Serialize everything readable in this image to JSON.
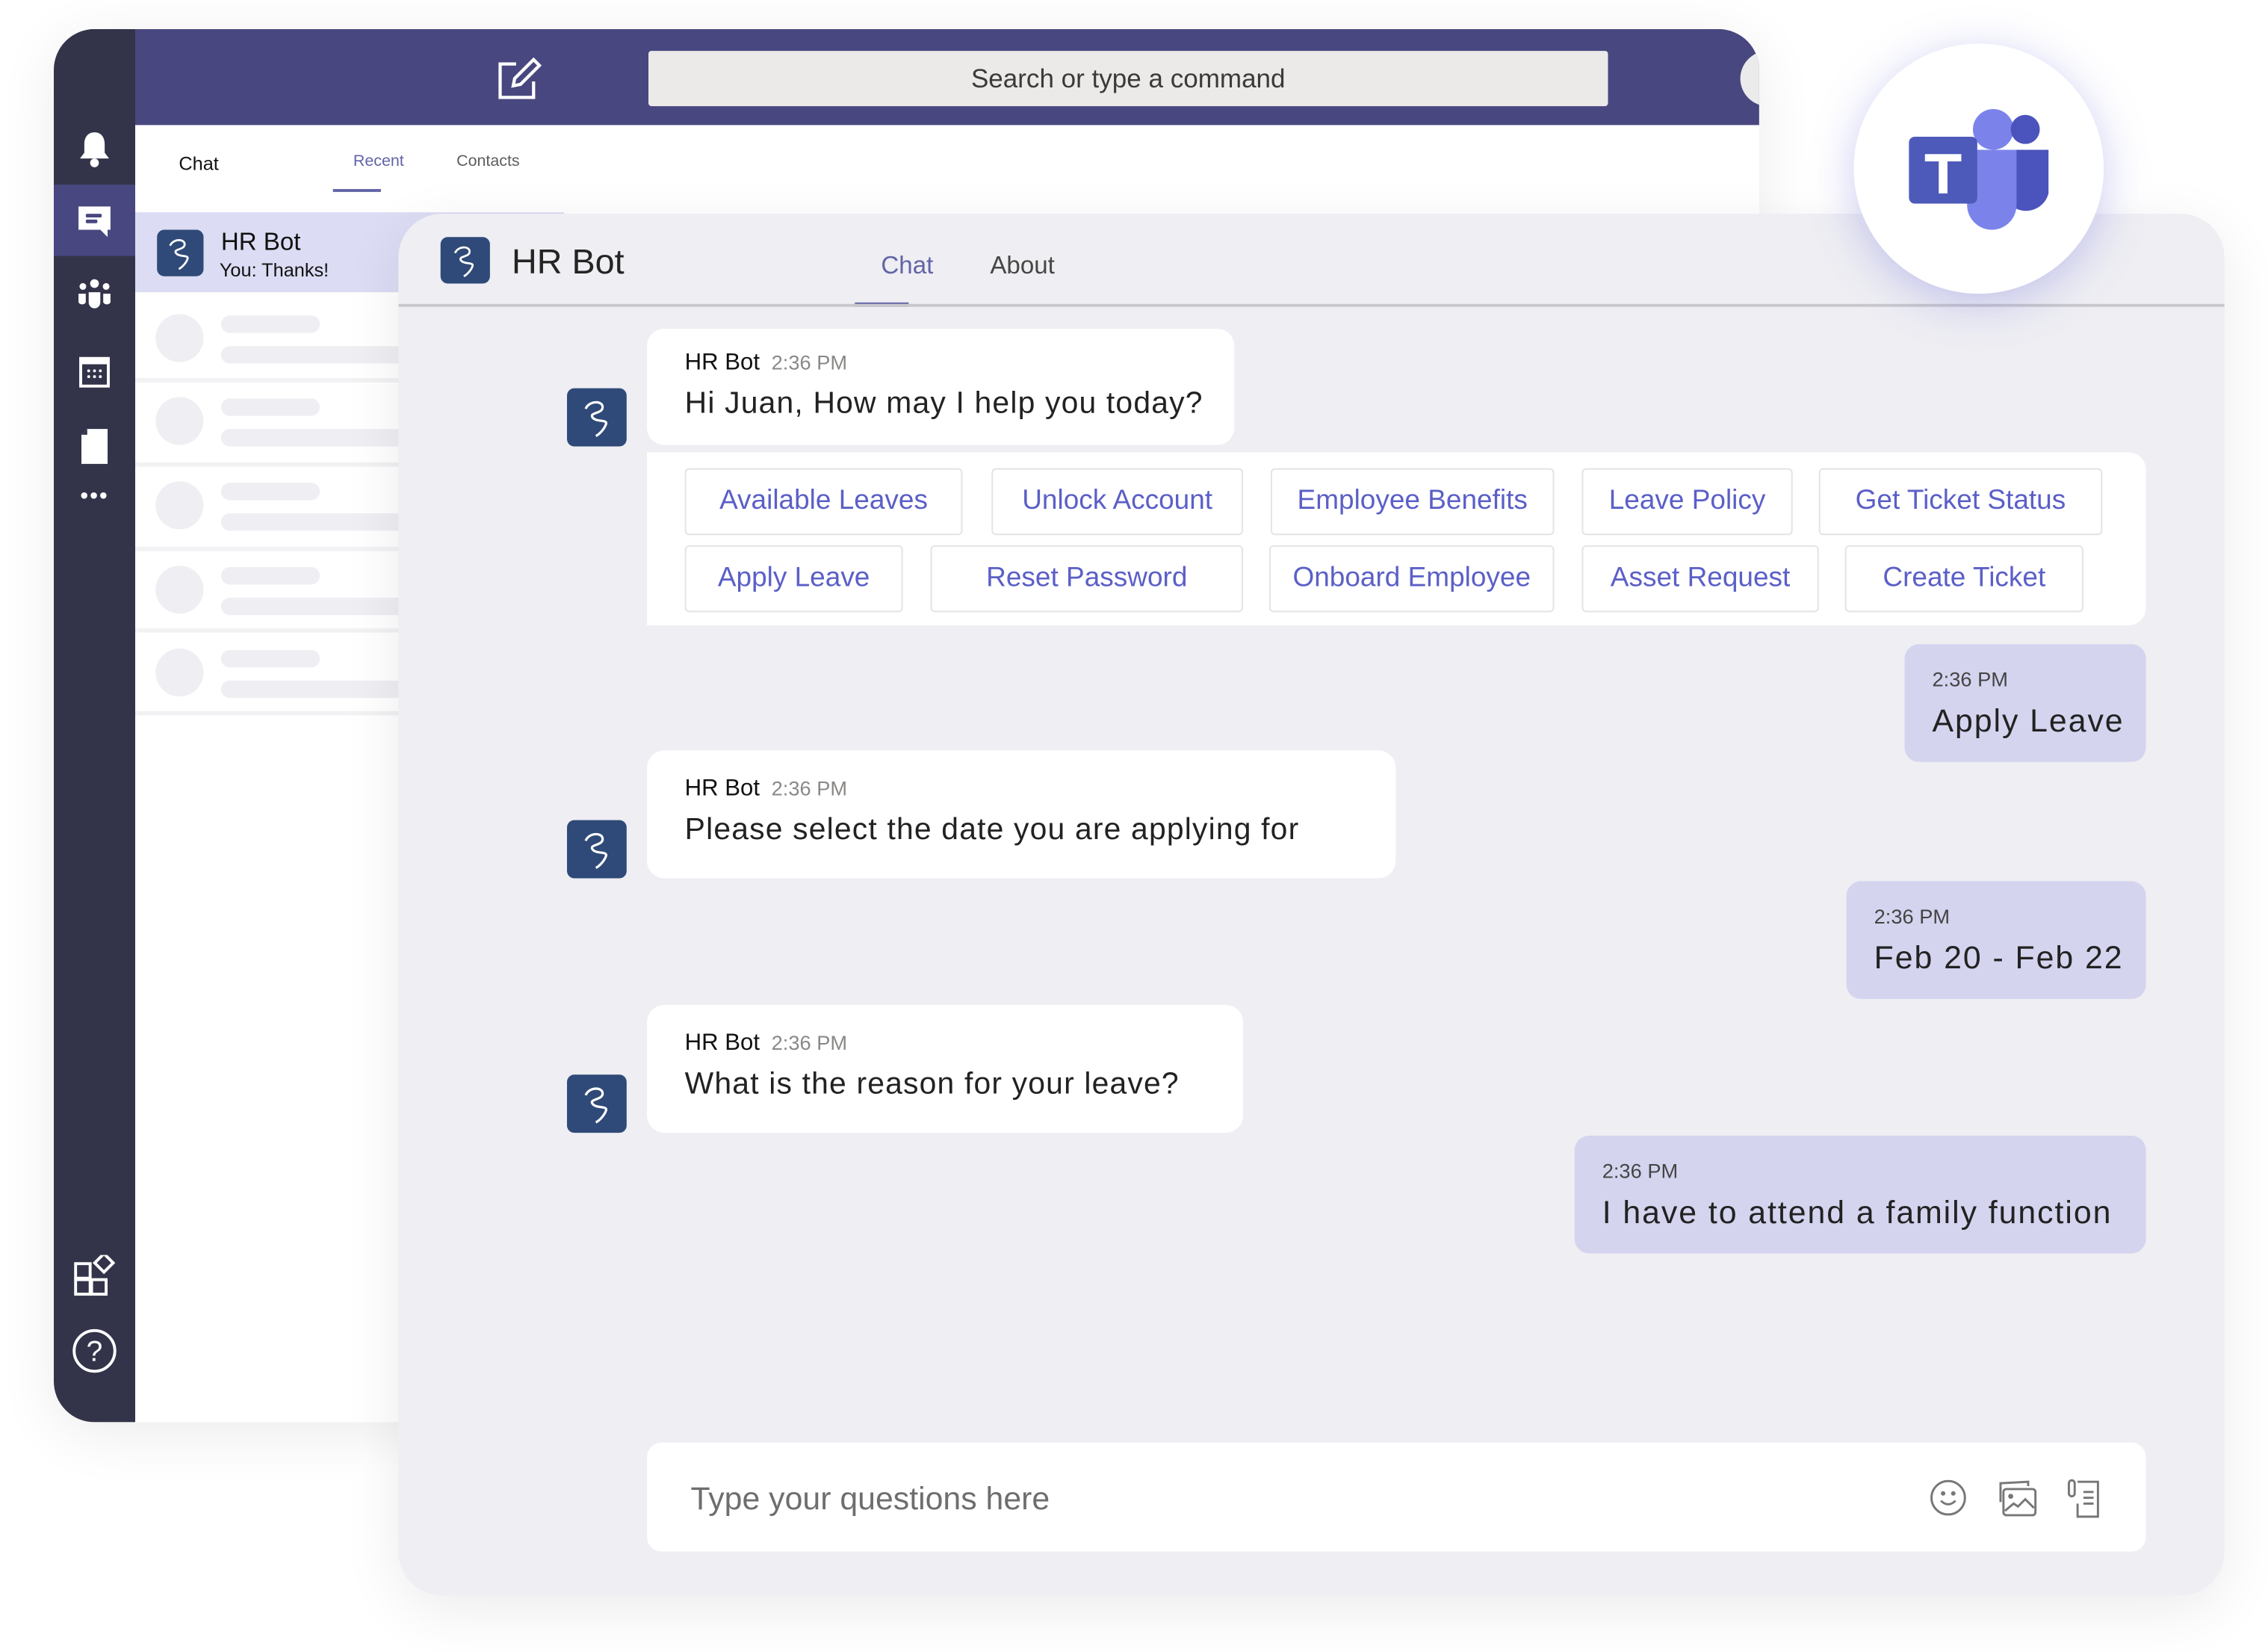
{
  "topbar": {
    "search_placeholder": "Search or type a command"
  },
  "rail": {
    "items": [
      "bell-icon",
      "chat-icon",
      "teams-icon",
      "calendar-icon",
      "files-icon",
      "more-icon",
      "apps-icon",
      "help-icon"
    ]
  },
  "chat_list": {
    "title": "Chat",
    "tabs": [
      "Recent",
      "Contacts"
    ],
    "active_tab": "Recent",
    "items": [
      {
        "name": "HR Bot",
        "preview": "You: Thanks!"
      }
    ]
  },
  "conversation": {
    "title": "HR Bot",
    "tabs": [
      "Chat",
      "About"
    ],
    "active_tab": "Chat",
    "messages": [
      {
        "from": "bot",
        "name": "HR Bot",
        "time": "2:36 PM",
        "text": "Hi Juan, How may I help you today?"
      },
      {
        "from": "user",
        "time": "2:36 PM",
        "text": "Apply Leave"
      },
      {
        "from": "bot",
        "name": "HR Bot",
        "time": "2:36 PM",
        "text": "Please select the date you are applying for"
      },
      {
        "from": "user",
        "time": "2:36 PM",
        "text": "Feb 20 - Feb 22"
      },
      {
        "from": "bot",
        "name": "HR Bot",
        "time": "2:36 PM",
        "text": "What is the reason for your leave?"
      },
      {
        "from": "user",
        "time": "2:36 PM",
        "text": "I have to attend a family function"
      }
    ],
    "quick_replies": [
      "Available Leaves",
      "Unlock Account",
      "Employee Benefits",
      "Leave Policy",
      "Get Ticket Status",
      "Apply Leave",
      "Reset Password",
      "Onboard Employee",
      "Asset Request",
      "Create Ticket"
    ],
    "composer": {
      "placeholder": "Type your questions here",
      "icons": [
        "emoji-icon",
        "image-icon",
        "attach-icon"
      ]
    }
  },
  "colors": {
    "brand": "#484780",
    "rail": "#33344a",
    "accent": "#5b5fc7",
    "user_bubble": "#d4d4ef",
    "bot_avatar": "#2f4a78"
  }
}
